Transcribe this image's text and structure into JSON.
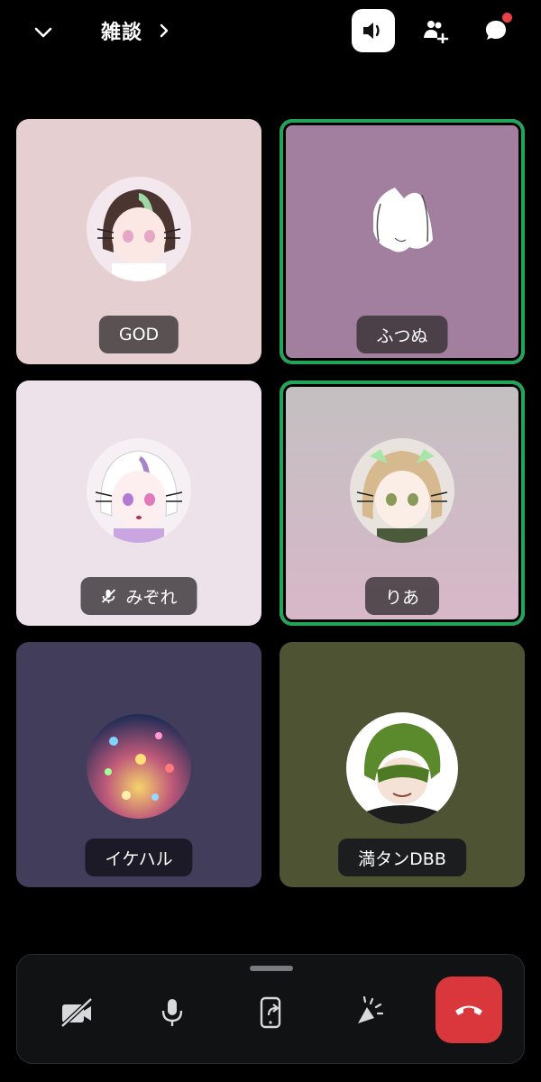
{
  "header": {
    "channel_name": "雑談",
    "icons": [
      "chevron-down-icon",
      "chevron-right-icon",
      "speaker-icon",
      "add-user-icon",
      "chat-bubble-icon"
    ],
    "chat_has_notification": true
  },
  "participants": [
    {
      "name": "GOD",
      "speaking": false,
      "muted": false,
      "bg": "#e6cfd0"
    },
    {
      "name": "ふつぬ",
      "speaking": true,
      "muted": false,
      "bg": "#a27f9f"
    },
    {
      "name": "みぞれ",
      "speaking": false,
      "muted": true,
      "bg": "#ede1ea"
    },
    {
      "name": "りあ",
      "speaking": true,
      "muted": false,
      "bg": "#cdb7c3"
    },
    {
      "name": "イケハル",
      "speaking": false,
      "muted": false,
      "bg": "#433d5c"
    },
    {
      "name": "満タンDBB",
      "speaking": false,
      "muted": false,
      "bg": "#4d5333"
    }
  ],
  "controls": {
    "icons": [
      "camera-off-icon",
      "microphone-icon",
      "screen-share-icon",
      "soundboard-icon",
      "end-call-icon"
    ],
    "end_call_color": "#da373c",
    "speaking_ring_color": "#23a559"
  }
}
